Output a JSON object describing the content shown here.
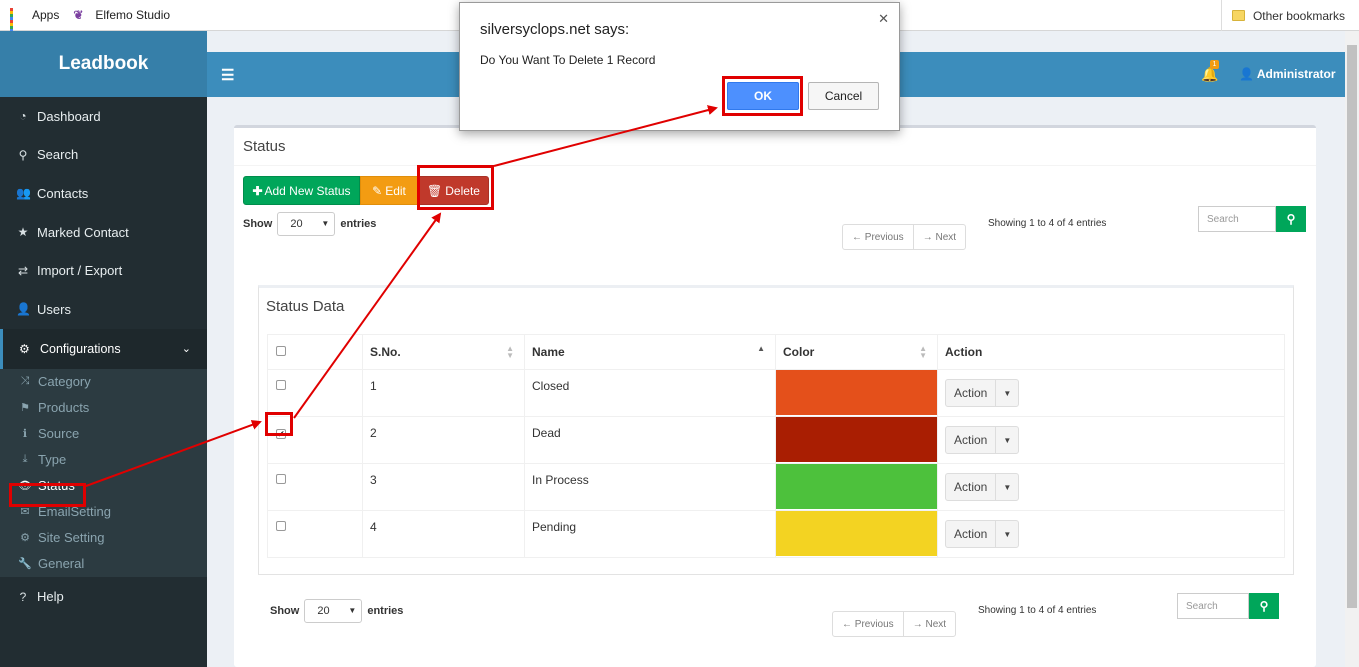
{
  "bookmarks": {
    "apps": "Apps",
    "site": "Elfemo Studio",
    "other": "Other bookmarks"
  },
  "brand": "Leadbook",
  "sidebar": {
    "items": [
      {
        "label": "Dashboard",
        "icon": "dashboard-icon",
        "glyph": "◔"
      },
      {
        "label": "Search",
        "icon": "search-icon",
        "glyph": "⚲"
      },
      {
        "label": "Contacts",
        "icon": "users-icon",
        "glyph": "👥"
      },
      {
        "label": "Marked Contact",
        "icon": "star-icon",
        "glyph": "★"
      },
      {
        "label": "Import / Export",
        "icon": "exchange-icon",
        "glyph": "⇄"
      },
      {
        "label": "Users",
        "icon": "user-icon",
        "glyph": "👤"
      }
    ],
    "configurations": "Configurations",
    "sub": [
      {
        "label": "Category",
        "glyph": "⤨"
      },
      {
        "label": "Products",
        "glyph": "⚑"
      },
      {
        "label": "Source",
        "glyph": "ℹ"
      },
      {
        "label": "Type",
        "glyph": "⤓"
      },
      {
        "label": "Status",
        "glyph": "👁"
      },
      {
        "label": "EmailSetting",
        "glyph": "✉"
      },
      {
        "label": "Site Setting",
        "glyph": "⚙"
      },
      {
        "label": "General",
        "glyph": "🔧"
      }
    ],
    "help": "Help"
  },
  "topbar": {
    "notifications": "1",
    "user": "Administrator"
  },
  "page": {
    "title": "Status",
    "add": "Add New Status",
    "edit": "Edit",
    "delete": "Delete",
    "show": "Show",
    "entries": "entries",
    "page_length": "20",
    "prev": "← Previous",
    "next": "→ Next",
    "info": "Showing 1 to 4 of 4 entries",
    "search_placeholder": "Search"
  },
  "table": {
    "title": "Status Data",
    "headers": {
      "sno": "S.No.",
      "name": "Name",
      "color": "Color",
      "action": "Action"
    },
    "action_label": "Action",
    "rows": [
      {
        "sno": "1",
        "name": "Closed",
        "color": "#e4501b",
        "checked": false
      },
      {
        "sno": "2",
        "name": "Dead",
        "color": "#a91e02",
        "checked": true
      },
      {
        "sno": "3",
        "name": "In Process",
        "color": "#4dc13c",
        "checked": false
      },
      {
        "sno": "4",
        "name": "Pending",
        "color": "#f3d322",
        "checked": false
      }
    ]
  },
  "dialog": {
    "title": "silversyclops.net says:",
    "message": "Do You Want To Delete 1 Record",
    "ok": "OK",
    "cancel": "Cancel"
  }
}
